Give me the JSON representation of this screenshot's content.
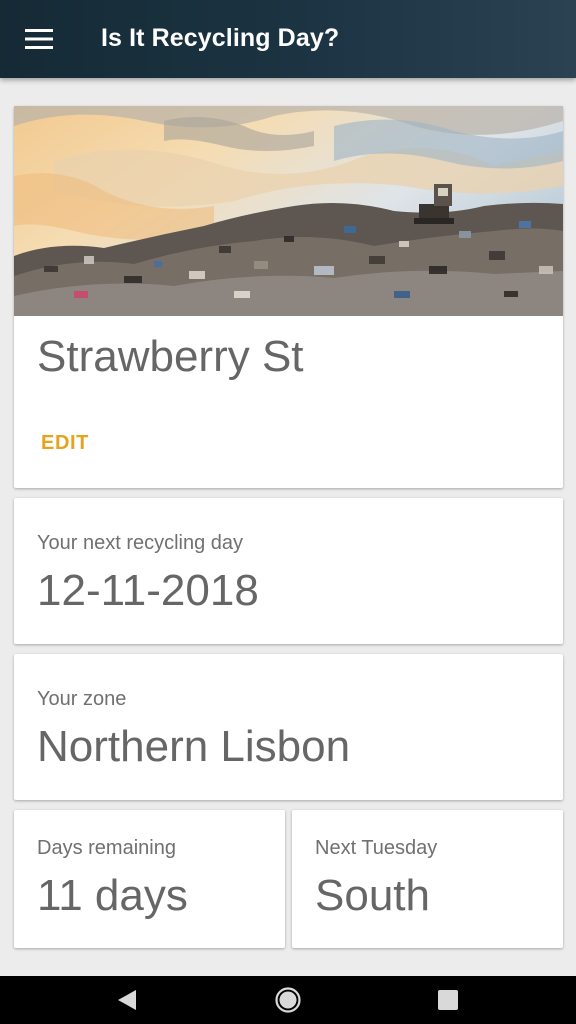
{
  "app_bar": {
    "title": "Is It Recycling Day?",
    "menu_icon": "hamburger-menu-icon",
    "background": "#1c3443"
  },
  "street_card": {
    "street": "Strawberry St",
    "edit_label": "EDIT",
    "edit_color": "#e8a21c",
    "image": "landfill-illustration"
  },
  "next_day_card": {
    "label": "Your next recycling day",
    "value": "12-11-2018"
  },
  "zone_card": {
    "label": "Your zone",
    "value": "Northern Lisbon"
  },
  "days_card": {
    "label": "Days remaining",
    "value": "11 days"
  },
  "tuesday_card": {
    "label": "Next Tuesday",
    "value": "South"
  },
  "nav_bar": {
    "back_icon": "back-triangle-icon",
    "home_icon": "home-circle-icon",
    "recents_icon": "recents-square-icon"
  }
}
